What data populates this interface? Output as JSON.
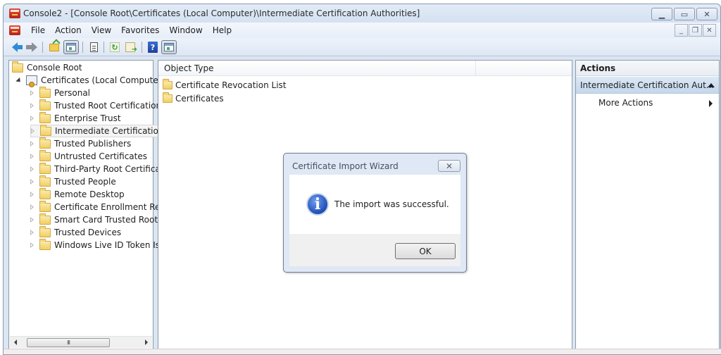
{
  "window": {
    "title": "Console2 - [Console Root\\Certificates (Local Computer)\\Intermediate Certification Authorities]",
    "caption_buttons": [
      "minimize",
      "maximize",
      "close"
    ]
  },
  "menubar": {
    "items": [
      "File",
      "Action",
      "View",
      "Favorites",
      "Window",
      "Help"
    ],
    "mdi_buttons": [
      "minimize",
      "restore",
      "close"
    ]
  },
  "toolbar": {
    "buttons": [
      "back",
      "forward",
      "up-one-level",
      "show-hide-console-tree",
      "properties",
      "refresh",
      "export-list",
      "help",
      "show-hide-action-pane"
    ]
  },
  "tree": {
    "root": "Console Root",
    "snapin": "Certificates (Local Computer)",
    "items": [
      {
        "label": "Personal",
        "selected": false
      },
      {
        "label": "Trusted Root Certification .",
        "selected": false
      },
      {
        "label": "Enterprise Trust",
        "selected": false
      },
      {
        "label": "Intermediate Certification .",
        "selected": true
      },
      {
        "label": "Trusted Publishers",
        "selected": false
      },
      {
        "label": "Untrusted Certificates",
        "selected": false
      },
      {
        "label": "Third-Party Root Certificat",
        "selected": false
      },
      {
        "label": "Trusted People",
        "selected": false
      },
      {
        "label": "Remote Desktop",
        "selected": false
      },
      {
        "label": "Certificate Enrollment Requ",
        "selected": false
      },
      {
        "label": "Smart Card Trusted Roots",
        "selected": false
      },
      {
        "label": "Trusted Devices",
        "selected": false
      },
      {
        "label": "Windows Live ID Token Iss",
        "selected": false
      }
    ],
    "scrollbar_thumb_label": "III"
  },
  "list": {
    "column_header": "Object Type",
    "rows": [
      "Certificate Revocation List",
      "Certificates"
    ]
  },
  "actions": {
    "header": "Actions",
    "group_label": "Intermediate Certification Aut...",
    "items": [
      "More Actions"
    ]
  },
  "dialog": {
    "title": "Certificate Import Wizard",
    "close_glyph": "✕",
    "icon": "info-icon",
    "message": "The import was successful.",
    "ok_label": "OK"
  },
  "colors": {
    "frame": "#dbe6f3",
    "action_group_bg": "#c4d7ec",
    "folder": "#f1cf63",
    "info_icon": "#1f4fb5"
  }
}
